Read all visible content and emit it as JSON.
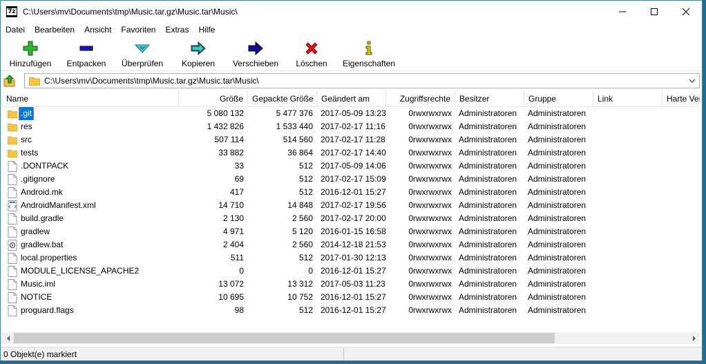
{
  "window": {
    "title": "C:\\Users\\mv\\Documents\\tmp\\Music.tar.gz\\Music.tar\\Music\\",
    "app_icon_text": "7z"
  },
  "menu": [
    "Datei",
    "Bearbeiten",
    "Ansicht",
    "Favoriten",
    "Extras",
    "Hilfe"
  ],
  "toolbar": [
    {
      "label": "Hinzufügen",
      "icon": "plus-icon",
      "color": "#2fb52f"
    },
    {
      "label": "Entpacken",
      "icon": "minus-icon",
      "color": "#1a1aa8"
    },
    {
      "label": "Überprüfen",
      "icon": "check-icon",
      "color": "#1aa0b8"
    },
    {
      "label": "Kopieren",
      "icon": "copy-arrow-icon",
      "color": "#1a7a7a"
    },
    {
      "label": "Verschieben",
      "icon": "move-arrow-icon",
      "color": "#101080"
    },
    {
      "label": "Löschen",
      "icon": "delete-x-icon",
      "color": "#e01010"
    },
    {
      "label": "Eigenschaften",
      "icon": "info-icon",
      "color": "#d8c800"
    }
  ],
  "address": {
    "path": "C:\\Users\\mv\\Documents\\tmp\\Music.tar.gz\\Music.tar\\Music\\"
  },
  "columns": [
    "Name",
    "Größe",
    "Gepackte Größe",
    "Geändert am",
    "Zugriffsrechte",
    "Besitzer",
    "Gruppe",
    "Link",
    "Harte Verknüpfungen"
  ],
  "files": [
    {
      "name": ".git",
      "type": "folder",
      "size": "5 080 132",
      "packed": "5 477 376",
      "modified": "2017-05-09 13:23",
      "perm": "0rwxrwxrwx",
      "owner": "Administratoren",
      "group": "Administratoren",
      "selected": true
    },
    {
      "name": "res",
      "type": "folder",
      "size": "1 432 826",
      "packed": "1 533 440",
      "modified": "2017-02-17 11:16",
      "perm": "0rwxrwxrwx",
      "owner": "Administratoren",
      "group": "Administratoren"
    },
    {
      "name": "src",
      "type": "folder",
      "size": "507 114",
      "packed": "514 560",
      "modified": "2017-02-17 11:28",
      "perm": "0rwxrwxrwx",
      "owner": "Administratoren",
      "group": "Administratoren"
    },
    {
      "name": "tests",
      "type": "folder",
      "size": "33 882",
      "packed": "36 864",
      "modified": "2017-02-17 14:40",
      "perm": "0rwxrwxrwx",
      "owner": "Administratoren",
      "group": "Administratoren"
    },
    {
      "name": ".DONTPACK",
      "type": "file",
      "size": "33",
      "packed": "512",
      "modified": "2017-05-09 14:06",
      "perm": "0rwxrwxrwx",
      "owner": "Administratoren",
      "group": "Administratoren"
    },
    {
      "name": ".gitignore",
      "type": "file",
      "size": "69",
      "packed": "512",
      "modified": "2017-02-17 15:09",
      "perm": "0rwxrwxrwx",
      "owner": "Administratoren",
      "group": "Administratoren"
    },
    {
      "name": "Android.mk",
      "type": "file",
      "size": "417",
      "packed": "512",
      "modified": "2016-12-01 15:27",
      "perm": "0rwxrwxrwx",
      "owner": "Administratoren",
      "group": "Administratoren"
    },
    {
      "name": "AndroidManifest.xml",
      "type": "xml",
      "size": "14 710",
      "packed": "14 848",
      "modified": "2017-02-17 19:56",
      "perm": "0rwxrwxrwx",
      "owner": "Administratoren",
      "group": "Administratoren"
    },
    {
      "name": "build.gradle",
      "type": "file",
      "size": "2 130",
      "packed": "2 560",
      "modified": "2017-02-17 20:00",
      "perm": "0rwxrwxrwx",
      "owner": "Administratoren",
      "group": "Administratoren"
    },
    {
      "name": "gradlew",
      "type": "file",
      "size": "4 971",
      "packed": "5 120",
      "modified": "2016-01-15 16:58",
      "perm": "0rwxrwxrwx",
      "owner": "Administratoren",
      "group": "Administratoren"
    },
    {
      "name": "gradlew.bat",
      "type": "bat",
      "size": "2 404",
      "packed": "2 560",
      "modified": "2014-12-18 21:53",
      "perm": "0rwxrwxrwx",
      "owner": "Administratoren",
      "group": "Administratoren"
    },
    {
      "name": "local.properties",
      "type": "file",
      "size": "511",
      "packed": "512",
      "modified": "2017-01-30 12:13",
      "perm": "0rwxrwxrwx",
      "owner": "Administratoren",
      "group": "Administratoren"
    },
    {
      "name": "MODULE_LICENSE_APACHE2",
      "type": "file",
      "size": "0",
      "packed": "0",
      "modified": "2016-12-01 15:27",
      "perm": "0rwxrwxrwx",
      "owner": "Administratoren",
      "group": "Administratoren"
    },
    {
      "name": "Music.iml",
      "type": "file",
      "size": "13 072",
      "packed": "13 312",
      "modified": "2017-05-03 11:23",
      "perm": "0rwxrwxrwx",
      "owner": "Administratoren",
      "group": "Administratoren"
    },
    {
      "name": "NOTICE",
      "type": "file",
      "size": "10 695",
      "packed": "10 752",
      "modified": "2016-12-01 15:27",
      "perm": "0rwxrwxrwx",
      "owner": "Administratoren",
      "group": "Administratoren"
    },
    {
      "name": "proguard.flags",
      "type": "file",
      "size": "98",
      "packed": "512",
      "modified": "2016-12-01 15:27",
      "perm": "0rwxrwxrwx",
      "owner": "Administratoren",
      "group": "Administratoren"
    }
  ],
  "status": {
    "text": "0 Objekt(e) markiert"
  },
  "colors": {
    "selection": "#0078d7",
    "folder": "#f5c342",
    "window_border": "#1e8fb0"
  }
}
